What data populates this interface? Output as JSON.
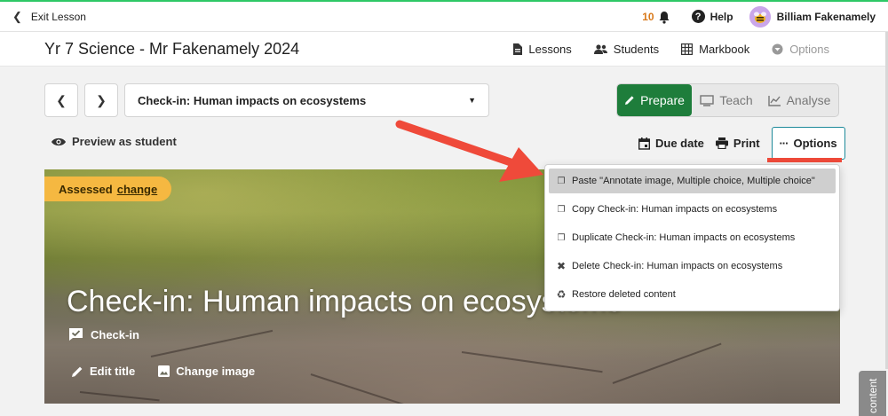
{
  "topbar": {
    "exit_label": "Exit Lesson",
    "notification_count": "10",
    "help_label": "Help",
    "user_name": "Billiam Fakenamely"
  },
  "classbar": {
    "class_name": "Yr 7 Science - Mr Fakenamely 2024",
    "nav": {
      "lessons": "Lessons",
      "students": "Students",
      "markbook": "Markbook",
      "options": "Options"
    }
  },
  "lesson": {
    "selected": "Check-in: Human impacts on ecosystems"
  },
  "modes": {
    "prepare": "Prepare",
    "teach": "Teach",
    "analyse": "Analyse",
    "active": "prepare"
  },
  "toolbar": {
    "preview": "Preview as student",
    "due_date": "Due date",
    "print": "Print",
    "options": "Options"
  },
  "hero": {
    "badge": "Assessed",
    "badge_link": "change",
    "title": "Check-in: Human impacts on ecosystems",
    "type": "Check-in",
    "edit_title": "Edit title",
    "change_image": "Change image"
  },
  "options_menu": {
    "items": [
      {
        "label": "Paste \"Annotate image, Multiple choice, Multiple choice\"",
        "icon": "paste-icon",
        "highlighted": true
      },
      {
        "label": "Copy Check-in: Human impacts on ecosystems",
        "icon": "copy-icon"
      },
      {
        "label": "Duplicate Check-in: Human impacts on ecosystems",
        "icon": "duplicate-icon"
      },
      {
        "label": "Delete Check-in: Human impacts on ecosystems",
        "icon": "delete-icon"
      },
      {
        "label": "Restore deleted content",
        "icon": "restore-icon"
      }
    ]
  },
  "sidetab": {
    "label": "content"
  },
  "colors": {
    "prepare_active": "#1e7d3b",
    "top_accent": "#2ec866",
    "badge": "#f5b841",
    "arrow": "#ef4a3a"
  }
}
